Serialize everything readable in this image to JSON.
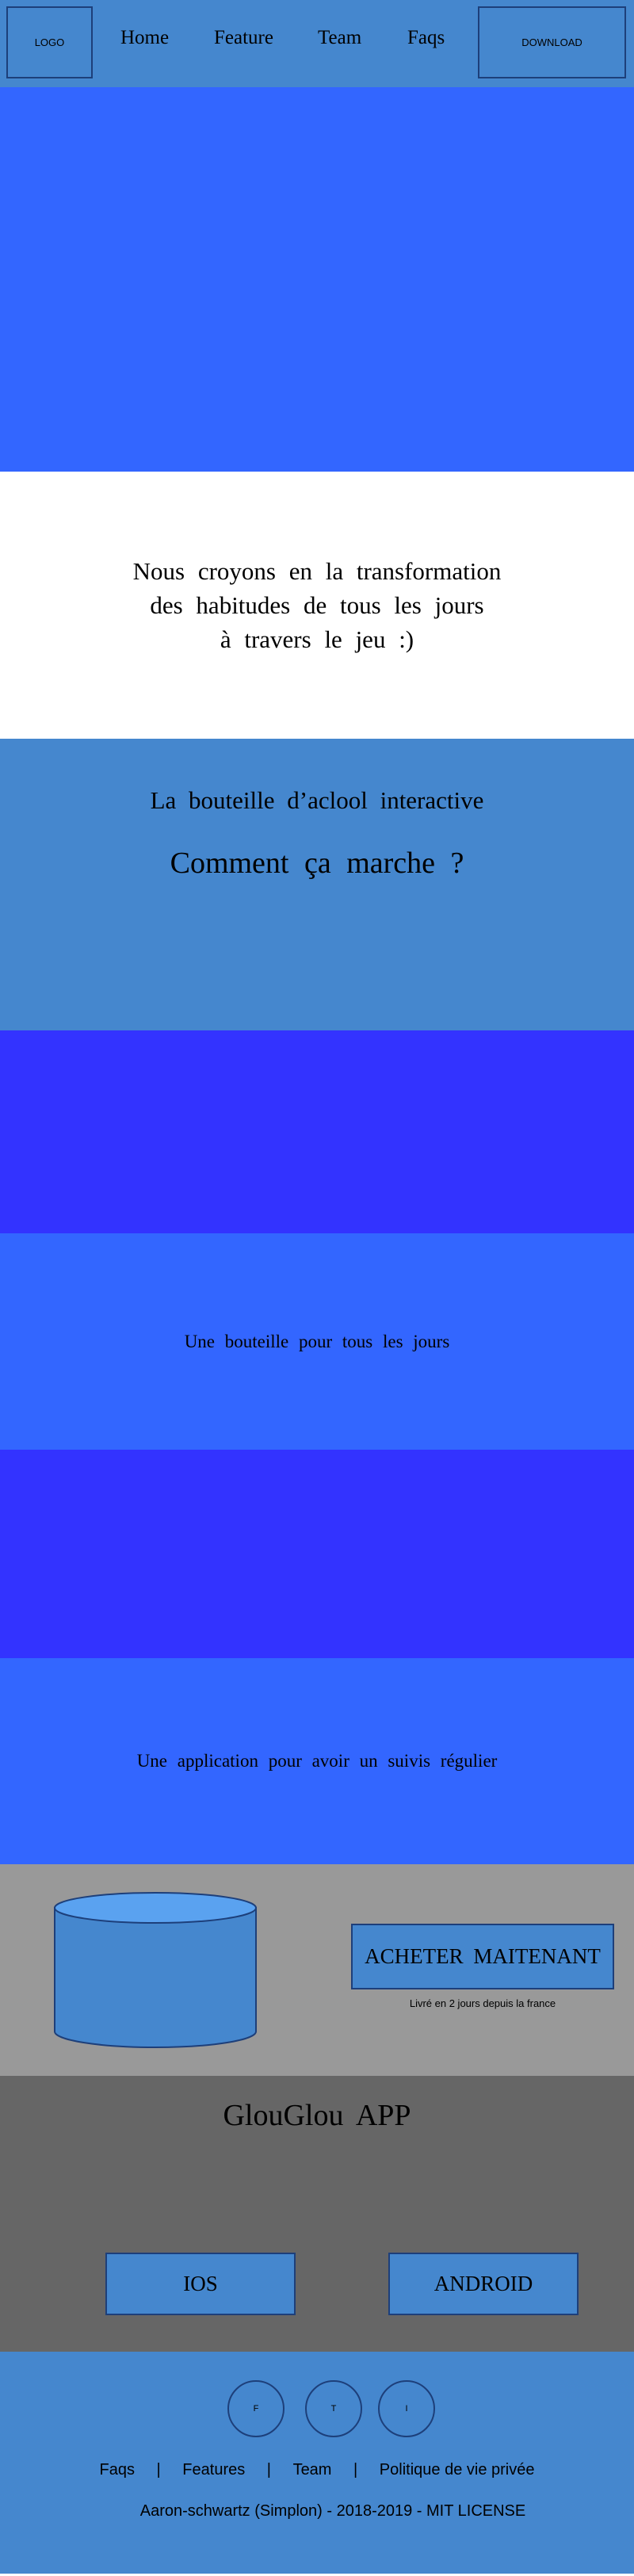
{
  "header": {
    "logo": "LOGO",
    "nav": [
      "Home",
      "Feature",
      "Team",
      "Faqs"
    ],
    "download": "DOWNLOAD"
  },
  "belief": {
    "lines": [
      "Nous croyons en la transformation",
      "des habitudes de tous les jours",
      "à travers le jeu :)"
    ]
  },
  "how": {
    "subtitle": "La bouteille d’aclool interactive",
    "title": "Comment ça marche ?"
  },
  "features": {
    "bottle": "Une bouteille pour tous les jours",
    "app": "Une application pour avoir un suivis régulier"
  },
  "product": {
    "buy": "ACHETER MAITENANT",
    "delivery": "Livré en 2 jours depuis la france"
  },
  "app": {
    "title": "GlouGlou APP",
    "ios": "IOS",
    "android": "ANDROID"
  },
  "footer": {
    "social": [
      "F",
      "T",
      "I"
    ],
    "links": [
      "Faqs",
      "Features",
      "Team",
      "Politique de vie privée"
    ],
    "separator": "|",
    "license": "Aaron-schwartz (Simplon) - 2018-2019 - MIT LICENSE"
  },
  "colors": {
    "header": "#4587ce",
    "hero": "#3366ff",
    "band_dark": "#3333ff",
    "product_bg": "#999999",
    "app_bg": "#666666",
    "footer": "#4587ce",
    "cylinder_top": "#5aa2f0"
  }
}
